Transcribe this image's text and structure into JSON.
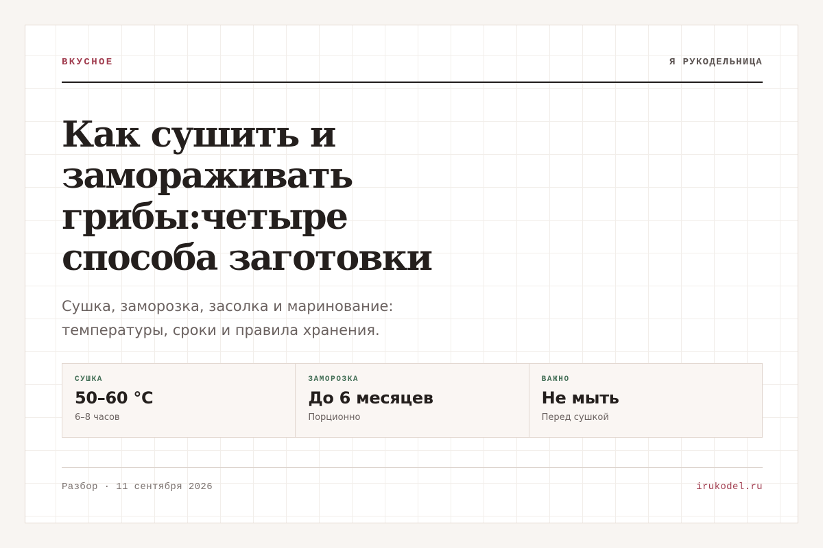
{
  "header": {
    "section": "ВКУСНОЕ",
    "site": "Я РУКОДЕЛЬНИЦА"
  },
  "article": {
    "title": "Как сушить и замораживать грибы:четыре способа заготовки",
    "subtitle": "Сушка, заморозка, засолка и маринование: температуры, сроки и правила хранения."
  },
  "facts": [
    {
      "label": "СУШКА",
      "value": "50–60 °C",
      "note": "6–8 часов"
    },
    {
      "label": "ЗАМОРОЗКА",
      "value": "До 6 месяцев",
      "note": "Порционно"
    },
    {
      "label": "ВАЖНО",
      "value": "Не мыть",
      "note": "Перед сушкой"
    }
  ],
  "footer": {
    "meta": "Разбор · 11 сентября 2026",
    "domain": "irukodel.ru"
  },
  "colors": {
    "accent": "#a13d4f",
    "label_green": "#3f6b52",
    "text": "#241f1d",
    "muted": "#6b6260"
  }
}
